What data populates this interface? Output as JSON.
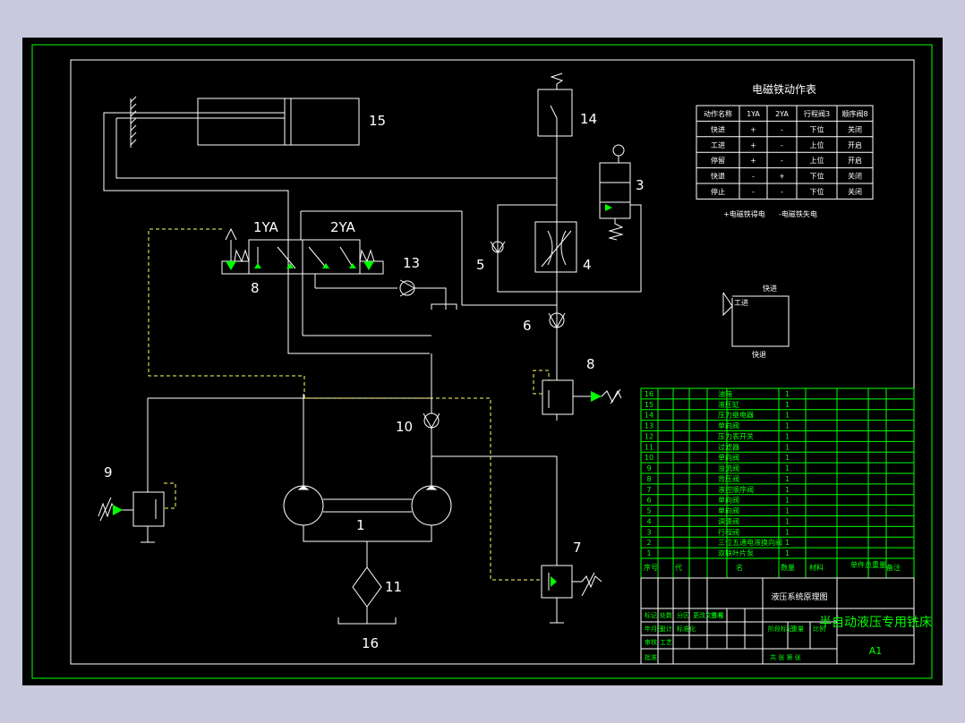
{
  "colors": {
    "background": "#000000",
    "page": "#c9c9dd",
    "line": "#ffffff",
    "accent": "#00ff00",
    "dash": "#ffff66"
  },
  "component_labels": {
    "c1": "1",
    "c3": "3",
    "c4": "4",
    "c5": "5",
    "c6": "6",
    "c7": "7",
    "c8a": "8",
    "c8b": "8",
    "c9": "9",
    "c10": "10",
    "c11": "11",
    "c13": "13",
    "c14": "14",
    "c15": "15",
    "c16": "16",
    "ya1": "1YA",
    "ya2": "2YA"
  },
  "solenoid_table": {
    "title": "电磁铁动作表",
    "headers": [
      "动作名称",
      "1YA",
      "2YA",
      "行程阀3",
      "顺序阀8"
    ],
    "rows": [
      [
        "快进",
        "+",
        "-",
        "下位",
        "关闭"
      ],
      [
        "工进",
        "+",
        "-",
        "上位",
        "开启"
      ],
      [
        "停留",
        "+",
        "-",
        "上位",
        "开启"
      ],
      [
        "快退",
        "-",
        "+",
        "下位",
        "关闭"
      ],
      [
        "停止",
        "-",
        "-",
        "下位",
        "关闭"
      ]
    ],
    "legend_on": "+电磁铁得电",
    "legend_off": "-电磁铁失电"
  },
  "cycle_diagram": {
    "fast_in": "快进",
    "work_in": "工进",
    "fast_back": "快退"
  },
  "parts_list": {
    "rows": [
      {
        "no": "16",
        "name": "油箱",
        "qty": "1"
      },
      {
        "no": "15",
        "name": "液压缸",
        "qty": "1"
      },
      {
        "no": "14",
        "name": "压力继电器",
        "qty": "1"
      },
      {
        "no": "13",
        "name": "单向阀",
        "qty": "1"
      },
      {
        "no": "12",
        "name": "压力表开关",
        "qty": "1"
      },
      {
        "no": "11",
        "name": "过滤器",
        "qty": "1"
      },
      {
        "no": "10",
        "name": "单向阀",
        "qty": "1"
      },
      {
        "no": "9",
        "name": "溢流阀",
        "qty": "1"
      },
      {
        "no": "8",
        "name": "背压阀",
        "qty": "1"
      },
      {
        "no": "7",
        "name": "液控顺序阀",
        "qty": "1"
      },
      {
        "no": "6",
        "name": "单向阀",
        "qty": "1"
      },
      {
        "no": "5",
        "name": "单向阀",
        "qty": "1"
      },
      {
        "no": "4",
        "name": "调速阀",
        "qty": "1"
      },
      {
        "no": "3",
        "name": "行程阀",
        "qty": "1"
      },
      {
        "no": "2",
        "name": "三位五通电液换向阀",
        "qty": "1"
      },
      {
        "no": "1",
        "name": "双联叶片泵",
        "qty": "1"
      }
    ],
    "header": {
      "no": "序号",
      "code": "代",
      "name": "名",
      "qty": "数量",
      "material": "材料",
      "weight": "单件总重量",
      "note": "备注"
    }
  },
  "title_block": {
    "drawing_name": "液压系统原理图",
    "product": "半自动液压专用铣床",
    "size": "A1",
    "labels": [
      "标记",
      "处数",
      "分区",
      "更改文件号",
      "签名",
      "年月日",
      "设计",
      "标准化",
      "阶段标记",
      "重量",
      "比例",
      "审核",
      "工艺",
      "批准",
      "共 张 第 张"
    ]
  }
}
